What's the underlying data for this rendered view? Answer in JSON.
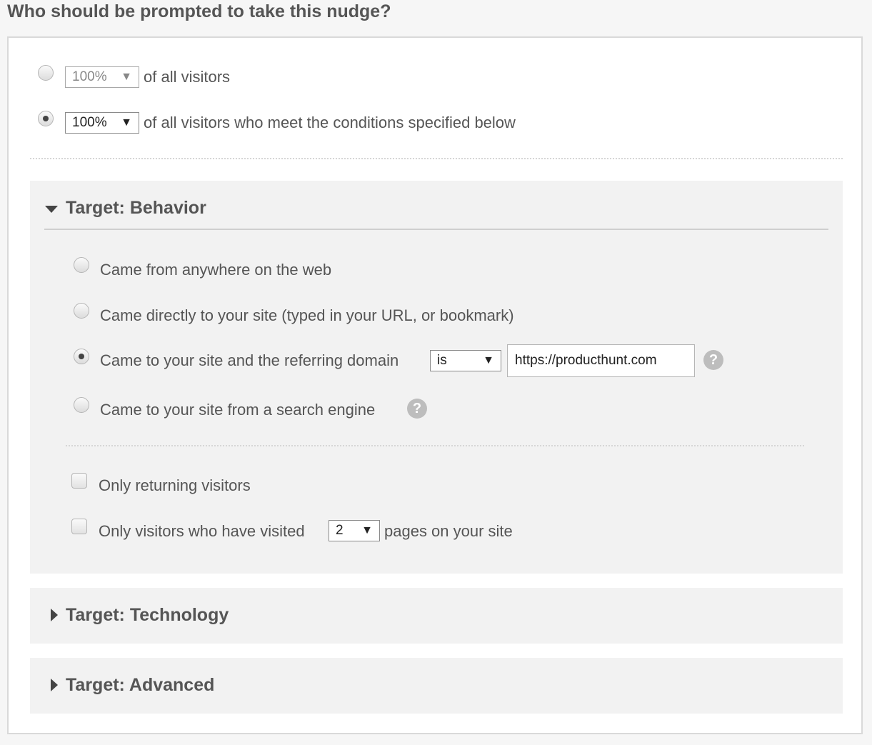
{
  "heading": "Who should be prompted to take this nudge?",
  "audience": {
    "options": [
      {
        "percent": "100%",
        "label": "of all visitors",
        "selected": false
      },
      {
        "percent": "100%",
        "label": "of all visitors who meet the conditions specified below",
        "selected": true
      }
    ]
  },
  "behavior": {
    "title": "Target: Behavior",
    "expanded": true,
    "options": [
      {
        "label": "Came from anywhere on the web",
        "selected": false
      },
      {
        "label": "Came directly to your site (typed in your URL, or bookmark)",
        "selected": false
      },
      {
        "label": "Came to your site and the referring domain",
        "selected": true,
        "operator": "is",
        "value": "https://producthunt.com"
      },
      {
        "label": "Came to your site from a search engine",
        "selected": false
      }
    ],
    "checkboxes": [
      {
        "label": "Only returning visitors",
        "checked": false
      },
      {
        "label_before": "Only visitors who have visited",
        "pages": "2",
        "label_after": "pages on your site",
        "checked": false
      }
    ]
  },
  "technology": {
    "title": "Target: Technology",
    "expanded": false
  },
  "advanced": {
    "title": "Target: Advanced",
    "expanded": false
  },
  "icons": {
    "help": "?",
    "select_arrow": "▼"
  }
}
